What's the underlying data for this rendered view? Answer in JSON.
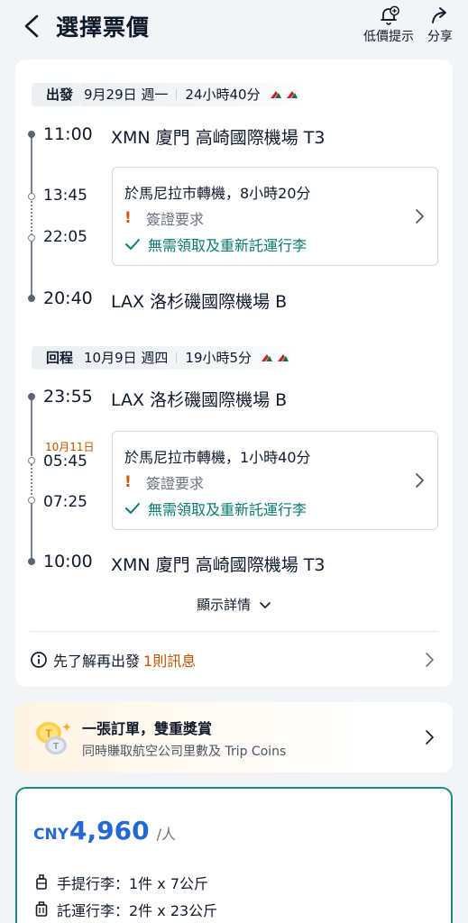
{
  "header": {
    "title": "選擇票價",
    "price_alert_label": "低價提示",
    "share_label": "分享"
  },
  "colors": {
    "accent_blue": "#2667d6",
    "teal": "#0a7a75",
    "orange": "#c25100",
    "warning": "#d9540b",
    "card_border": "#1b8b87"
  },
  "outbound": {
    "tag": "出發",
    "date": "9月29日 週一",
    "duration": "24小時40分",
    "depart_time": "11:00",
    "depart_airport": "XMN 廈門 高崎國際機場 T3",
    "arr_transfer_time": "13:45",
    "dep_transfer_time": "22:05",
    "transfer_text": "於馬尼拉市轉機，8小時20分",
    "visa_text": "簽證要求",
    "baggage_text": "無需領取及重新託運行李",
    "arrive_time": "20:40",
    "arrive_airport": "LAX 洛杉磯國際機場 B"
  },
  "return": {
    "tag": "回程",
    "date": "10月9日 週四",
    "duration": "19小時5分",
    "depart_time": "23:55",
    "depart_airport": "LAX 洛杉磯國際機場 B",
    "next_day_label": "10月11日",
    "arr_transfer_time": "05:45",
    "dep_transfer_time": "07:25",
    "transfer_text": "於馬尼拉市轉機，1小時40分",
    "visa_text": "簽證要求",
    "baggage_text": "無需領取及重新託運行李",
    "arrive_time": "10:00",
    "arrive_airport": "XMN 廈門 高崎國際機場 T3"
  },
  "details_label": "顯示詳情",
  "info": {
    "label": "先了解再出發",
    "count": "1則訊息"
  },
  "promo": {
    "title": "一張訂單，雙重獎賞",
    "subtitle": "同時賺取航空公司里數及 Trip Coins"
  },
  "price": {
    "currency": "CNY",
    "amount": "4,960",
    "per": "/人",
    "carry_on": "手提行李：1件 x 7公斤",
    "checked": "託運行李：2件 x 23公斤"
  }
}
